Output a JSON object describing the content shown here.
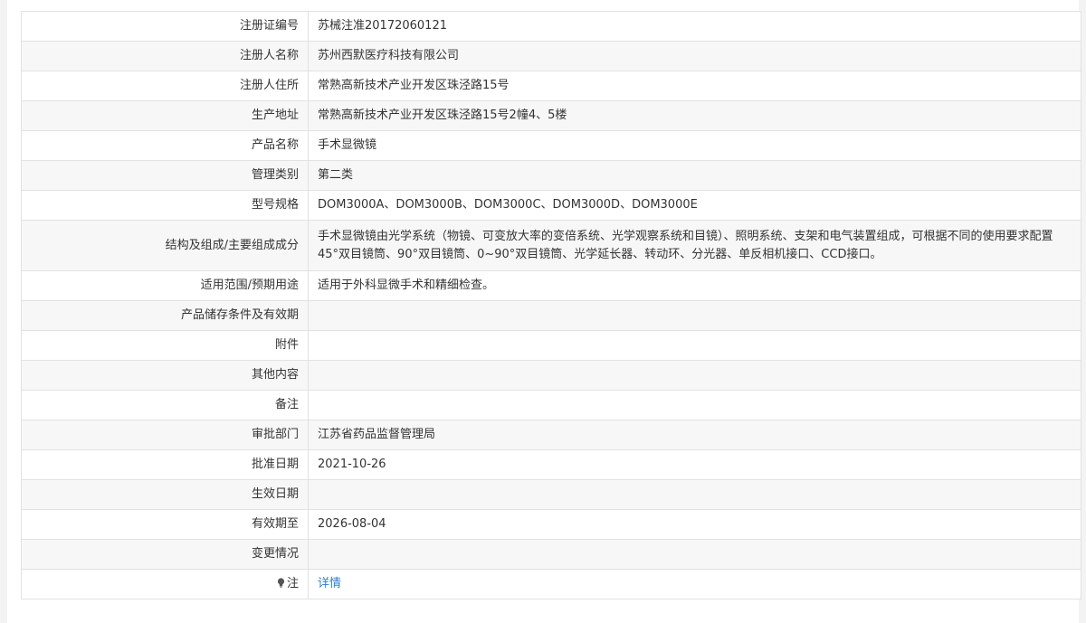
{
  "rows": [
    {
      "label": "注册证编号",
      "value": "苏械注准20172060121"
    },
    {
      "label": "注册人名称",
      "value": "苏州西默医疗科技有限公司"
    },
    {
      "label": "注册人住所",
      "value": "常熟高新技术产业开发区珠泾路15号"
    },
    {
      "label": "生产地址",
      "value": "常熟高新技术产业开发区珠泾路15号2幢4、5楼"
    },
    {
      "label": "产品名称",
      "value": "手术显微镜"
    },
    {
      "label": "管理类别",
      "value": "第二类"
    },
    {
      "label": "型号规格",
      "value": "DOM3000A、DOM3000B、DOM3000C、DOM3000D、DOM3000E"
    },
    {
      "label": "结构及组成/主要组成成分",
      "value": "手术显微镜由光学系统（物镜、可变放大率的变倍系统、光学观察系统和目镜）、照明系统、支架和电气装置组成，可根据不同的使用要求配置45°双目镜筒、90°双目镜筒、0~90°双目镜筒、光学延长器、转动环、分光器、单反相机接口、CCD接口。"
    },
    {
      "label": "适用范围/预期用途",
      "value": "适用于外科显微手术和精细检查。"
    },
    {
      "label": "产品储存条件及有效期",
      "value": ""
    },
    {
      "label": "附件",
      "value": ""
    },
    {
      "label": "其他内容",
      "value": ""
    },
    {
      "label": "备注",
      "value": ""
    },
    {
      "label": "审批部门",
      "value": "江苏省药品监督管理局"
    },
    {
      "label": "批准日期",
      "value": "2021-10-26"
    },
    {
      "label": "生效日期",
      "value": ""
    },
    {
      "label": "有效期至",
      "value": "2026-08-04"
    },
    {
      "label": "变更情况",
      "value": ""
    }
  ],
  "note": {
    "icon": "lightbulb-icon",
    "label": "注",
    "link_text": "详情"
  },
  "colors": {
    "link": "#2a7fd0",
    "border": "#e2e2e2",
    "stripe": "#f7f7f7"
  }
}
